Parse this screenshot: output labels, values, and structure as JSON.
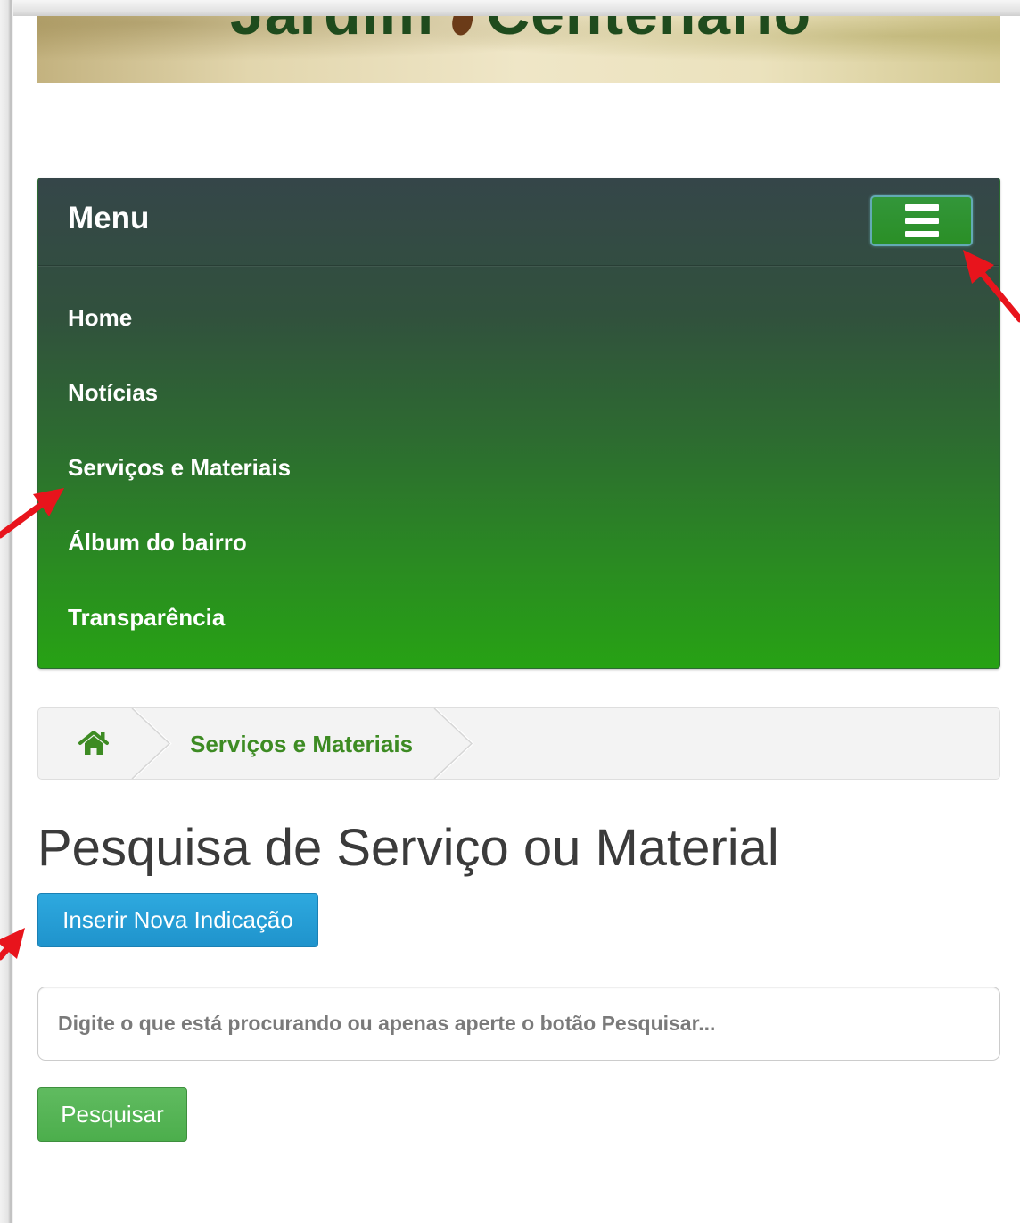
{
  "banner": {
    "logo_left": "Jardim",
    "logo_right": "Centenário",
    "leaf_icon": "leaf-icon"
  },
  "navbar": {
    "brand": "Menu",
    "toggle_icon": "hamburger-icon",
    "items": [
      {
        "label": "Home"
      },
      {
        "label": "Notícias"
      },
      {
        "label": "Serviços e Materiais"
      },
      {
        "label": "Álbum do bairro"
      },
      {
        "label": "Transparência"
      }
    ]
  },
  "breadcrumb": {
    "home_icon": "home-icon",
    "current": "Serviços e Materiais"
  },
  "page": {
    "title": "Pesquisa de Serviço ou Material"
  },
  "actions": {
    "new_label": "Inserir Nova Indicação"
  },
  "search": {
    "value": "",
    "placeholder": "Digite o que está procurando ou apenas aperte o botão Pesquisar...",
    "submit_label": "Pesquisar"
  },
  "annotations": {
    "icon": "red-arrow-icon"
  },
  "colors": {
    "menu_top": "#354649",
    "menu_bottom": "#27a214",
    "primary": "#1f93cc",
    "success": "#4cae4c",
    "link_green": "#3d8b23",
    "annotation": "#e8141c"
  }
}
